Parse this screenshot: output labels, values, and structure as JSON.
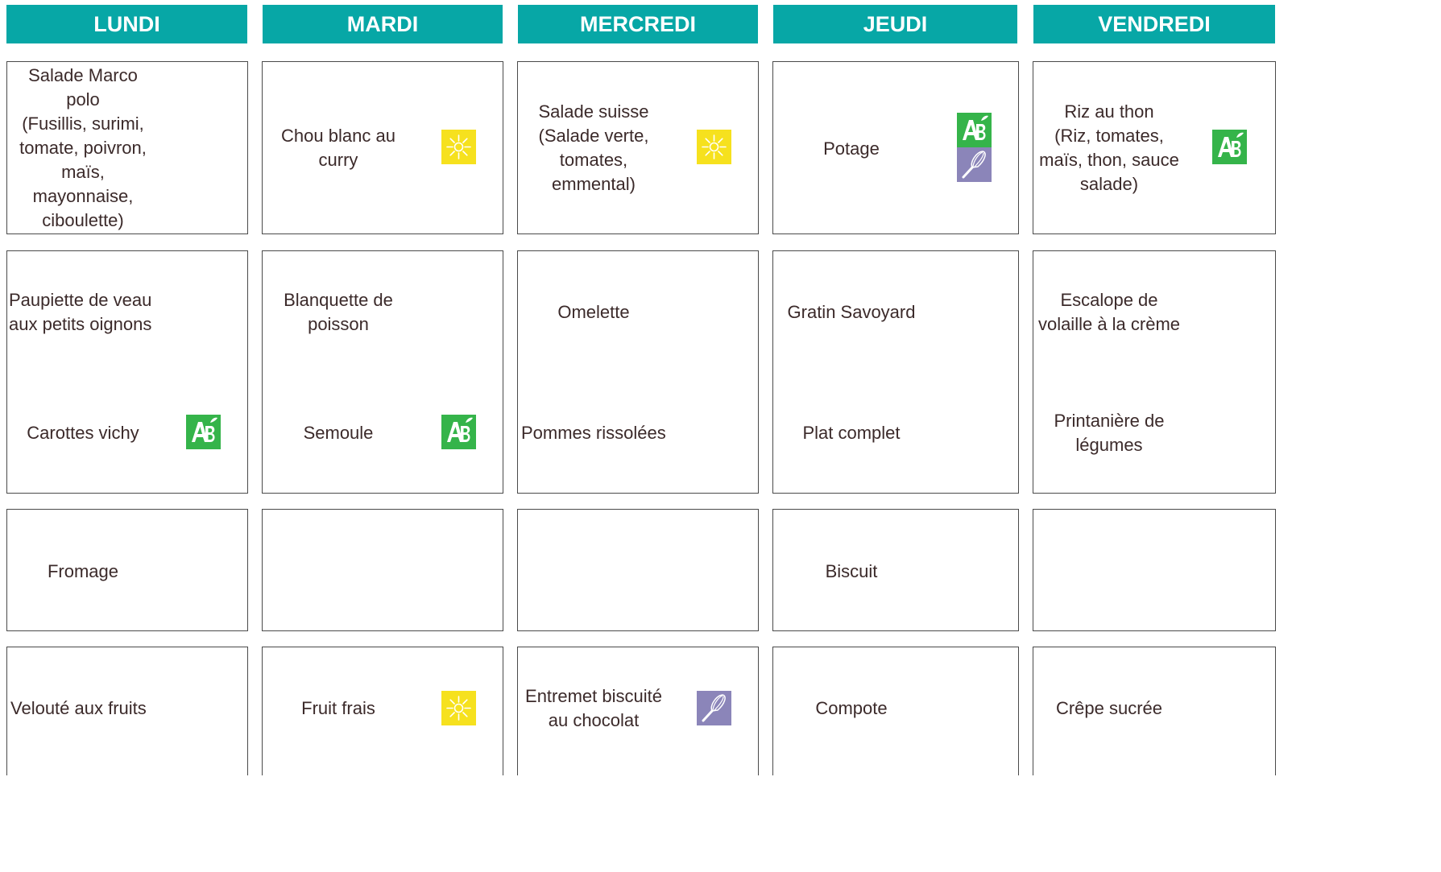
{
  "days": [
    "LUNDI",
    "MARDI",
    "MERCREDI",
    "JEUDI",
    "VENDREDI"
  ],
  "icons": {
    "sun": {
      "name": "sun-seasonal-icon",
      "color": "#f6e11e"
    },
    "ab": {
      "name": "ab-organic-label-icon",
      "color": "#35b44a"
    },
    "whisk": {
      "name": "homemade-whisk-icon",
      "color": "#8b85b9"
    }
  },
  "menu": {
    "lundi": {
      "entree": "Salade Marco\npolo\n(Fusillis, surimi,\ntomate, poivron,\nmaïs,\nmayonnaise,\nciboulette)",
      "plat": "Paupiette de veau\naux petits oignons",
      "accompagnement": "Carottes vichy",
      "laitage": "Fromage",
      "dessert": "Velouté aux fruits"
    },
    "mardi": {
      "entree": "Chou blanc au\ncurry",
      "plat": "Blanquette de\npoisson",
      "accompagnement": "Semoule",
      "dessert": "Fruit frais"
    },
    "mercredi": {
      "entree": "Salade suisse\n(Salade verte,\ntomates,\nemmental)",
      "plat": "Omelette",
      "accompagnement": "Pommes rissolées",
      "dessert": "Entremet biscuité\nau chocolat"
    },
    "jeudi": {
      "entree": "Potage",
      "plat": "Gratin Savoyard",
      "accompagnement": "Plat complet",
      "laitage": "Biscuit",
      "dessert": "Compote"
    },
    "vendredi": {
      "entree": "Riz au thon\n(Riz, tomates,\nmaïs, thon, sauce\nsalade)",
      "plat": "Escalope de\nvolaille à la crème",
      "accompagnement": "Printanière de\nlégumes",
      "dessert": "Crêpe sucrée"
    }
  }
}
